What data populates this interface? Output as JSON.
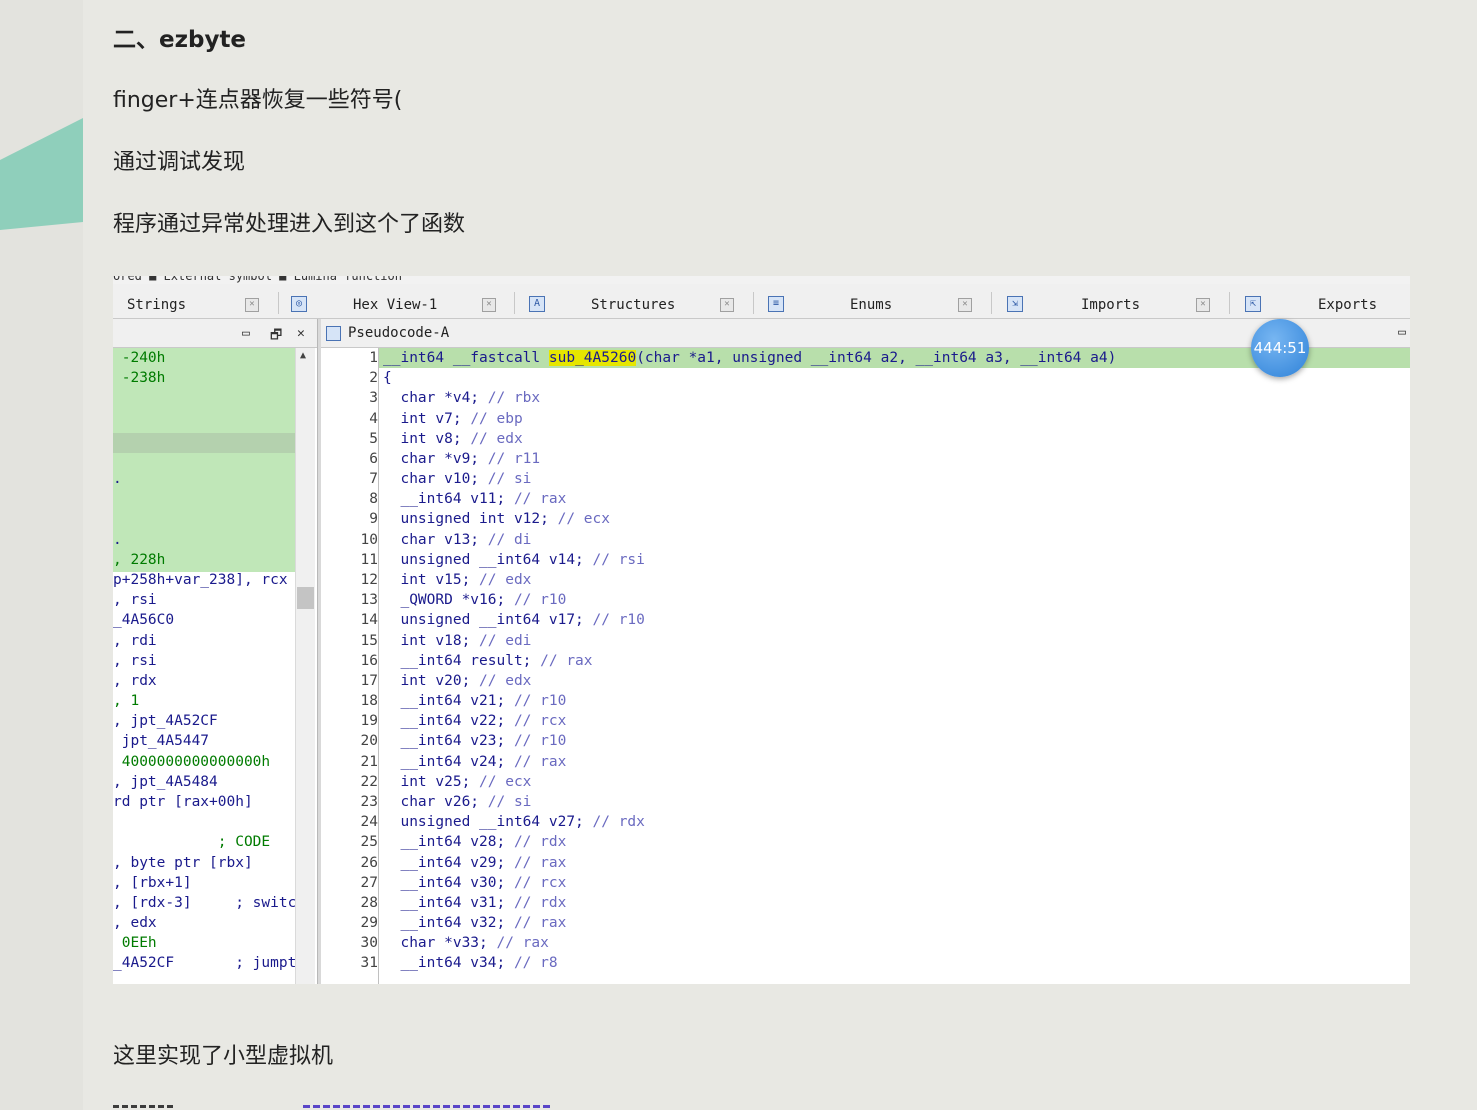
{
  "article": {
    "section_title": "二、ezbyte",
    "para1": "finger+连点器恢复一些符号(",
    "para2": "通过调试发现",
    "para3": "程序通过异常处理进入到这个了函数",
    "para4": "这里实现了小型虚拟机"
  },
  "ida": {
    "legend_text": "ored ■ External symbol ■ Lumina function",
    "tabs": [
      "Strings",
      "Hex View-1",
      "Structures",
      "Enums",
      "Imports",
      "Exports"
    ],
    "pseudo_title": "Pseudocode-A",
    "left_lines": [
      {
        "text": " -240h",
        "style": "green"
      },
      {
        "text": " -238h",
        "style": "green"
      },
      {
        "text": "",
        "style": ""
      },
      {
        "text": "",
        "style": ""
      },
      {
        "text": "",
        "style": ""
      },
      {
        "text": "",
        "style": ""
      },
      {
        "text": ".",
        "style": ""
      },
      {
        "text": "",
        "style": ""
      },
      {
        "text": "",
        "style": ""
      },
      {
        "text": ".",
        "style": ""
      },
      {
        "text": ", 228h",
        "style": "green"
      },
      {
        "text": "p+258h+var_238], rcx",
        "style": ""
      },
      {
        "text": ", rsi",
        "style": ""
      },
      {
        "text": "_4A56C0",
        "style": ""
      },
      {
        "text": ", rdi",
        "style": ""
      },
      {
        "text": ", rsi",
        "style": ""
      },
      {
        "text": ", rdx",
        "style": ""
      },
      {
        "text": ", 1",
        "style": "green"
      },
      {
        "text": ", jpt_4A52CF",
        "style": ""
      },
      {
        "text": " jpt_4A5447",
        "style": ""
      },
      {
        "text": " 4000000000000000h",
        "style": "green"
      },
      {
        "text": ", jpt_4A5484",
        "style": ""
      },
      {
        "text": "rd ptr [rax+00h]",
        "style": ""
      },
      {
        "text": "",
        "style": ""
      },
      {
        "text": "            ; CODE",
        "style": "green"
      },
      {
        "text": ", byte ptr [rbx]",
        "style": ""
      },
      {
        "text": ", [rbx+1]",
        "style": ""
      },
      {
        "text": ", [rdx-3]     ; switc",
        "style": ""
      },
      {
        "text": ", edx",
        "style": ""
      },
      {
        "text": " 0EEh",
        "style": "green"
      },
      {
        "text": "_4A52CF       ; jumpt",
        "style": ""
      }
    ],
    "line_numbers": [
      "1",
      "2",
      "3",
      "4",
      "5",
      "6",
      "7",
      "8",
      "9",
      "10",
      "11",
      "12",
      "13",
      "14",
      "15",
      "16",
      "17",
      "18",
      "19",
      "20",
      "21",
      "22",
      "23",
      "24",
      "25",
      "26",
      "27",
      "28",
      "29",
      "30",
      "31"
    ],
    "code": [
      {
        "code": "__int64 __fastcall ",
        "fn": "sub_4A5260",
        "rest": "(char *a1, unsigned __int64 a2, __int64 a3, __int64 a4)",
        "cm": ""
      },
      {
        "code": "{",
        "fn": "",
        "rest": "",
        "cm": ""
      },
      {
        "code": "  char *v4; ",
        "fn": "",
        "rest": "",
        "cm": "// rbx"
      },
      {
        "code": "  int v7; ",
        "fn": "",
        "rest": "",
        "cm": "// ebp"
      },
      {
        "code": "  int v8; ",
        "fn": "",
        "rest": "",
        "cm": "// edx"
      },
      {
        "code": "  char *v9; ",
        "fn": "",
        "rest": "",
        "cm": "// r11"
      },
      {
        "code": "  char v10; ",
        "fn": "",
        "rest": "",
        "cm": "// si"
      },
      {
        "code": "  __int64 v11; ",
        "fn": "",
        "rest": "",
        "cm": "// rax"
      },
      {
        "code": "  unsigned int v12; ",
        "fn": "",
        "rest": "",
        "cm": "// ecx"
      },
      {
        "code": "  char v13; ",
        "fn": "",
        "rest": "",
        "cm": "// di"
      },
      {
        "code": "  unsigned __int64 v14; ",
        "fn": "",
        "rest": "",
        "cm": "// rsi"
      },
      {
        "code": "  int v15; ",
        "fn": "",
        "rest": "",
        "cm": "// edx"
      },
      {
        "code": "  _QWORD *v16; ",
        "fn": "",
        "rest": "",
        "cm": "// r10"
      },
      {
        "code": "  unsigned __int64 v17; ",
        "fn": "",
        "rest": "",
        "cm": "// r10"
      },
      {
        "code": "  int v18; ",
        "fn": "",
        "rest": "",
        "cm": "// edi"
      },
      {
        "code": "  __int64 result; ",
        "fn": "",
        "rest": "",
        "cm": "// rax"
      },
      {
        "code": "  int v20; ",
        "fn": "",
        "rest": "",
        "cm": "// edx"
      },
      {
        "code": "  __int64 v21; ",
        "fn": "",
        "rest": "",
        "cm": "// r10"
      },
      {
        "code": "  __int64 v22; ",
        "fn": "",
        "rest": "",
        "cm": "// rcx"
      },
      {
        "code": "  __int64 v23; ",
        "fn": "",
        "rest": "",
        "cm": "// r10"
      },
      {
        "code": "  __int64 v24; ",
        "fn": "",
        "rest": "",
        "cm": "// rax"
      },
      {
        "code": "  int v25; ",
        "fn": "",
        "rest": "",
        "cm": "// ecx"
      },
      {
        "code": "  char v26; ",
        "fn": "",
        "rest": "",
        "cm": "// si"
      },
      {
        "code": "  unsigned __int64 v27; ",
        "fn": "",
        "rest": "",
        "cm": "// rdx"
      },
      {
        "code": "  __int64 v28; ",
        "fn": "",
        "rest": "",
        "cm": "// rdx"
      },
      {
        "code": "  __int64 v29; ",
        "fn": "",
        "rest": "",
        "cm": "// rax"
      },
      {
        "code": "  __int64 v30; ",
        "fn": "",
        "rest": "",
        "cm": "// rcx"
      },
      {
        "code": "  __int64 v31; ",
        "fn": "",
        "rest": "",
        "cm": "// rdx"
      },
      {
        "code": "  __int64 v32; ",
        "fn": "",
        "rest": "",
        "cm": "// rax"
      },
      {
        "code": "  char *v33; ",
        "fn": "",
        "rest": "",
        "cm": "// rax"
      },
      {
        "code": "  __int64 v34; ",
        "fn": "",
        "rest": "",
        "cm": "// r8"
      }
    ],
    "timer": "444:51"
  },
  "colors": {
    "page_bg": "#e8e8e3",
    "highlight_line": "#b8dfab",
    "left_green": "#c0e7b8",
    "function_highlight": "#e6e600",
    "badge": "#2f82d8"
  }
}
